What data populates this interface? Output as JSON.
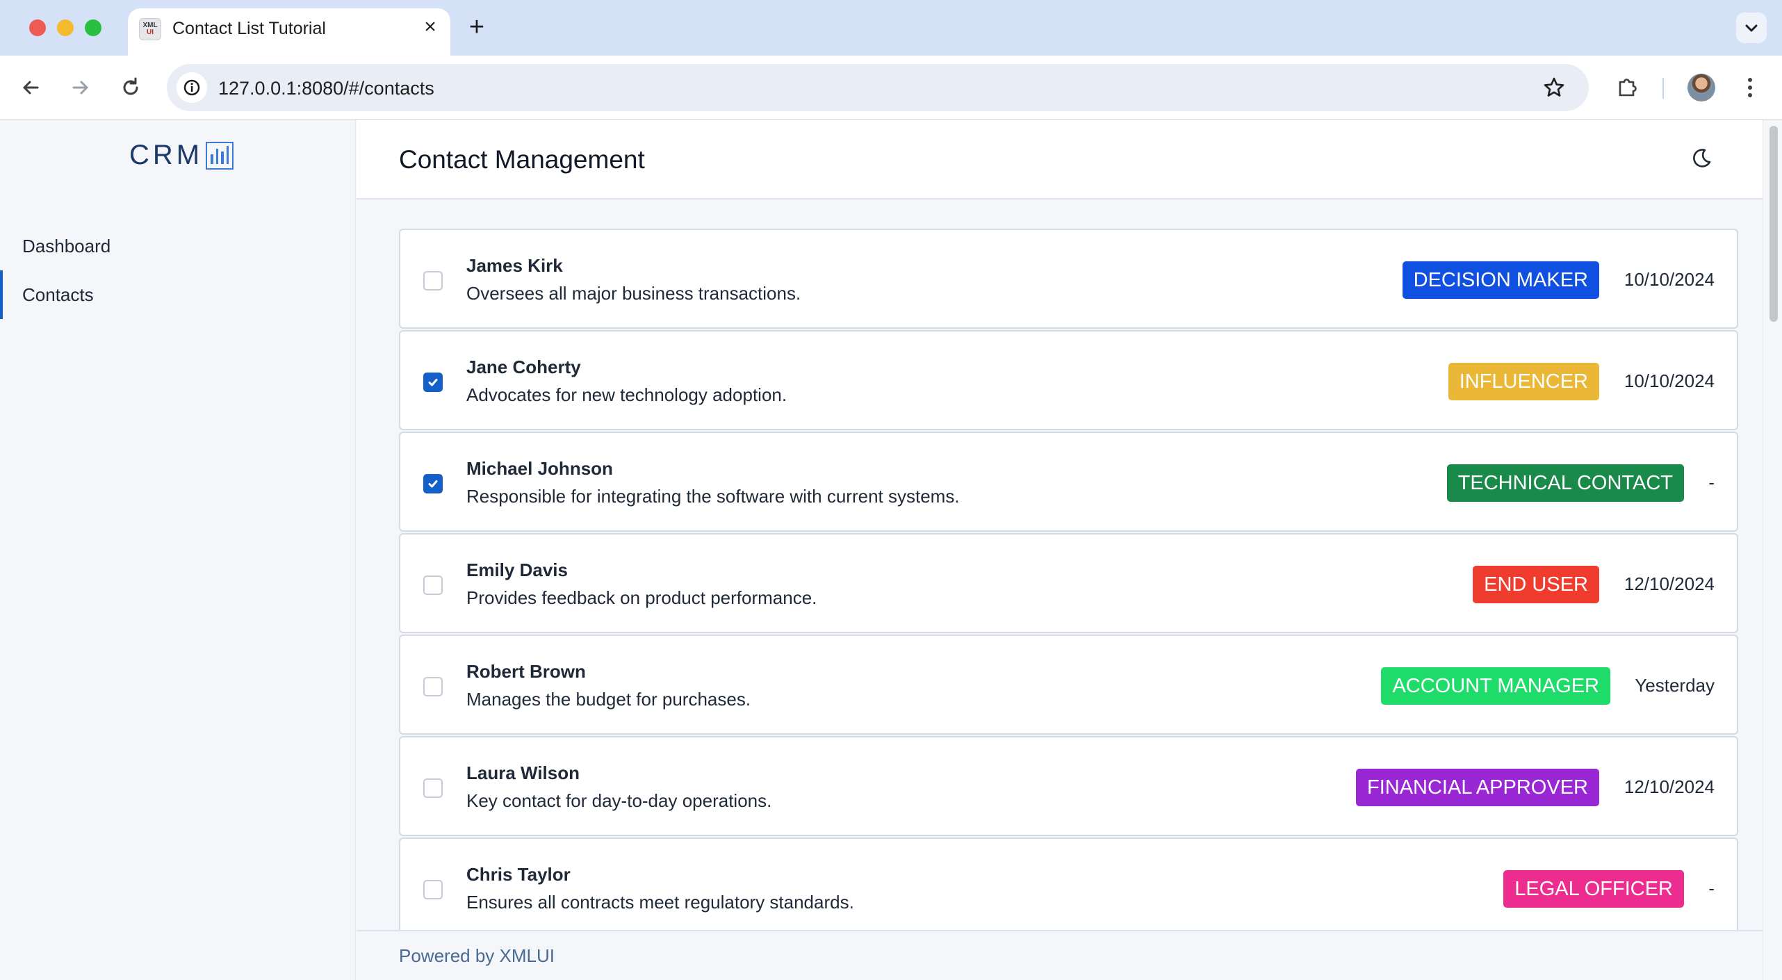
{
  "browser": {
    "tab_title": "Contact List Tutorial",
    "favicon_text_top": "XML",
    "favicon_text_bottom": "UI",
    "url": "127.0.0.1:8080/#/contacts"
  },
  "sidebar": {
    "logo_text": "CRM",
    "items": [
      {
        "label": "Dashboard",
        "active": false
      },
      {
        "label": "Contacts",
        "active": true
      }
    ]
  },
  "header": {
    "title": "Contact Management"
  },
  "contacts": [
    {
      "name": "James Kirk",
      "description": "Oversees all major business transactions.",
      "tag": "DECISION MAKER",
      "tag_color": "#1050e0",
      "date": "10/10/2024",
      "checked": false
    },
    {
      "name": "Jane Coherty",
      "description": "Advocates for new technology adoption.",
      "tag": "INFLUENCER",
      "tag_color": "#eab737",
      "date": "10/10/2024",
      "checked": true
    },
    {
      "name": "Michael Johnson",
      "description": "Responsible for integrating the software with current systems.",
      "tag": "TECHNICAL CONTACT",
      "tag_color": "#1a8a4a",
      "date": "-",
      "checked": true
    },
    {
      "name": "Emily Davis",
      "description": "Provides feedback on product performance.",
      "tag": "END USER",
      "tag_color": "#f03c2e",
      "date": "12/10/2024",
      "checked": false
    },
    {
      "name": "Robert Brown",
      "description": "Manages the budget for purchases.",
      "tag": "ACCOUNT MANAGER",
      "tag_color": "#1fdc6a",
      "date": "Yesterday",
      "checked": false
    },
    {
      "name": "Laura Wilson",
      "description": "Key contact for day-to-day operations.",
      "tag": "FINANCIAL APPROVER",
      "tag_color": "#9a27d4",
      "date": "12/10/2024",
      "checked": false
    },
    {
      "name": "Chris Taylor",
      "description": "Ensures all contracts meet regulatory standards.",
      "tag": "LEGAL OFFICER",
      "tag_color": "#ec2c8e",
      "date": "-",
      "checked": false
    }
  ],
  "footer": {
    "text": "Powered by XMLUI"
  }
}
